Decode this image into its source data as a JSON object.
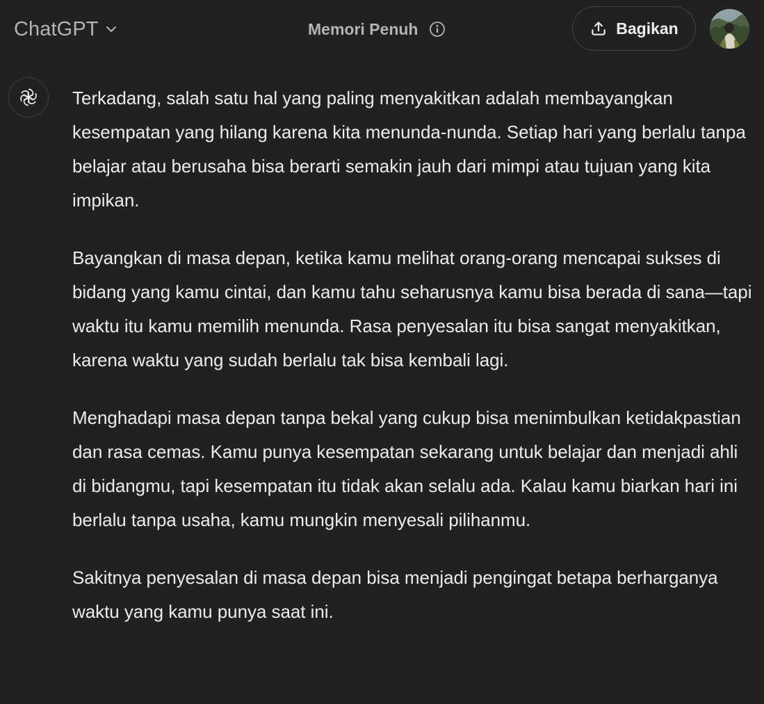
{
  "header": {
    "model_name": "ChatGPT",
    "memory_status": "Memori Penuh",
    "share_label": "Bagikan",
    "icons": {
      "model_chevron": "chevron-down-icon",
      "memory_info": "info-icon",
      "share": "upload-icon",
      "avatar": "user-avatar"
    }
  },
  "message": {
    "role_icon": "openai-logo-icon",
    "paragraphs": [
      "Terkadang, salah satu hal yang paling menyakitkan adalah membayangkan kesempatan yang hilang karena kita menunda-nunda. Setiap hari yang berlalu tanpa belajar atau berusaha bisa berarti semakin jauh dari mimpi atau tujuan yang kita impikan.",
      "Bayangkan di masa depan, ketika kamu melihat orang-orang mencapai sukses di bidang yang kamu cintai, dan kamu tahu seharusnya kamu bisa berada di sana—tapi waktu itu kamu memilih menunda. Rasa penyesalan itu bisa sangat menyakitkan, karena waktu yang sudah berlalu tak bisa kembali lagi.",
      "Menghadapi masa depan tanpa bekal yang cukup bisa menimbulkan ketidakpastian dan rasa cemas. Kamu punya kesempatan sekarang untuk belajar dan menjadi ahli di bidangmu, tapi kesempatan itu tidak akan selalu ada. Kalau kamu biarkan hari ini berlalu tanpa usaha, kamu mungkin menyesali pilihanmu.",
      "Sakitnya penyesalan di masa depan bisa menjadi pengingat betapa berharganya waktu yang kamu punya saat ini."
    ]
  },
  "colors": {
    "background": "#212121",
    "text_primary": "#ececec",
    "text_secondary": "#b4b4b4",
    "border": "#424242"
  }
}
